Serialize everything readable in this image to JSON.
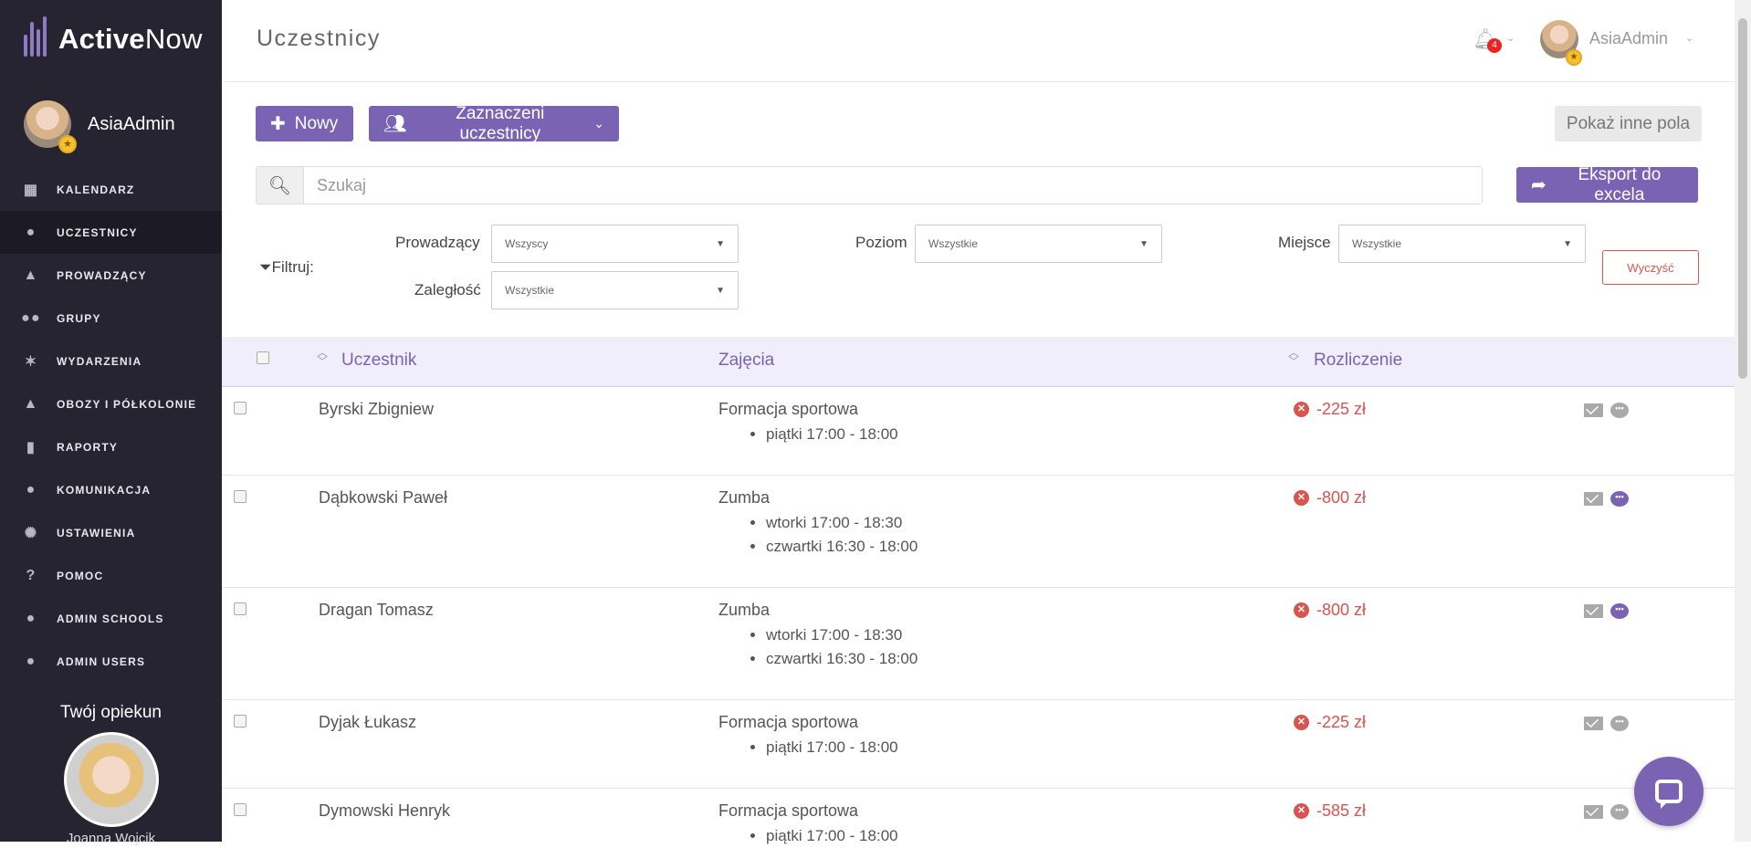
{
  "brand": {
    "name_bold": "Active",
    "name_light": "Now"
  },
  "sidebar": {
    "user_name": "AsiaAdmin",
    "items": [
      {
        "label": "KALENDARZ",
        "icon": "calendar-icon",
        "glyph": "▦"
      },
      {
        "label": "UCZESTNICY",
        "icon": "user-icon",
        "glyph": "●"
      },
      {
        "label": "PROWADZĄCY",
        "icon": "graduation-cap-icon",
        "glyph": "▲"
      },
      {
        "label": "GRUPY",
        "icon": "users-icon",
        "glyph": "●●"
      },
      {
        "label": "WYDARZENIA",
        "icon": "party-icon",
        "glyph": "✶"
      },
      {
        "label": "OBOZY I PÓŁKOLONIE",
        "icon": "tent-icon",
        "glyph": "▲"
      },
      {
        "label": "RAPORTY",
        "icon": "chart-icon",
        "glyph": "▮"
      },
      {
        "label": "KOMUNIKACJA",
        "icon": "chat-icon",
        "glyph": "●"
      },
      {
        "label": "USTAWIENIA",
        "icon": "gear-icon",
        "glyph": "✺"
      },
      {
        "label": "POMOC",
        "icon": "question-icon",
        "glyph": "?"
      },
      {
        "label": "ADMIN SCHOOLS",
        "icon": "user-icon",
        "glyph": "●"
      },
      {
        "label": "ADMIN USERS",
        "icon": "user-icon",
        "glyph": "●"
      }
    ],
    "guardian_title": "Twój opiekun",
    "guardian_name": "Joanna Wojcik"
  },
  "topbar": {
    "title": "Uczestnicy",
    "notifications_count": "4",
    "user_name": "AsiaAdmin"
  },
  "toolbar": {
    "new_label": "Nowy",
    "selected_label": "Zaznaczeni uczestnicy",
    "show_other_label": "Pokaż inne pola",
    "export_label": "Eksport do excela",
    "search_placeholder": "Szukaj"
  },
  "filters": {
    "label": "Filtruj:",
    "instructor_label": "Prowadzący",
    "instructor_value": "Wszyscy",
    "level_label": "Poziom",
    "level_value": "Wszystkie",
    "place_label": "Miejsce",
    "place_value": "Wszystkie",
    "debt_label": "Zaległość",
    "debt_value": "Wszystkie",
    "clear_label": "Wyczyść"
  },
  "table": {
    "headers": {
      "participant": "Uczestnik",
      "classes": "Zajęcia",
      "billing": "Rozliczenie"
    },
    "rows": [
      {
        "name": "Byrski Zbigniew",
        "class": "Formacja sportowa",
        "times": [
          "piątki 17:00 - 18:00"
        ],
        "balance": "-225 zł",
        "chat_active": false
      },
      {
        "name": "Dąbkowski Paweł",
        "class": "Zumba",
        "times": [
          "wtorki 17:00 - 18:30",
          "czwartki 16:30 - 18:00"
        ],
        "balance": "-800 zł",
        "chat_active": true
      },
      {
        "name": "Dragan Tomasz",
        "class": "Zumba",
        "times": [
          "wtorki 17:00 - 18:30",
          "czwartki 16:30 - 18:00"
        ],
        "balance": "-800 zł",
        "chat_active": true
      },
      {
        "name": "Dyjak Łukasz",
        "class": "Formacja sportowa",
        "times": [
          "piątki 17:00 - 18:00"
        ],
        "balance": "-225 zł",
        "chat_active": false
      },
      {
        "name": "Dymowski Henryk",
        "class": "Formacja sportowa",
        "times": [
          "piątki 17:00 - 18:00"
        ],
        "balance": "-585 zł",
        "chat_active": false
      }
    ]
  },
  "colors": {
    "accent": "#7b63b3",
    "sidebar": "#262431",
    "danger": "#d9534f"
  }
}
